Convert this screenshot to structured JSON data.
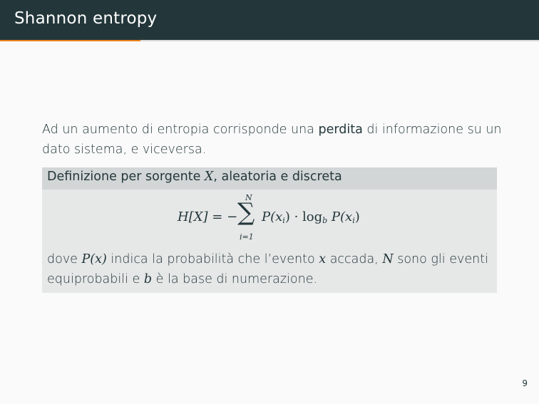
{
  "header": {
    "title": "Shannon entropy"
  },
  "progress": {
    "fraction": 0.26
  },
  "body": {
    "line_pre": "Ad un aumento di entropia corrisponde una ",
    "line_em": "perdita",
    "line_post": " di informazione su un dato sistema, e viceversa."
  },
  "block": {
    "title_pre": "Definizione per sorgente ",
    "title_var": "X",
    "title_post": ", aleatoria e discreta",
    "formula": {
      "lhs": "H[X] = −",
      "sum_symbol": "∑",
      "upper": "N",
      "lower": "i=1",
      "rhs_a": "P(x",
      "rhs_a_sub": "i",
      "rhs_b": ") · log",
      "rhs_b_sub": "b",
      "rhs_c": " P(x",
      "rhs_c_sub": "i",
      "rhs_d": ")"
    },
    "desc_1": "dove ",
    "desc_px": "P(x)",
    "desc_2": " indica la probabilità che l’evento ",
    "desc_x": "x",
    "desc_3": " accada, ",
    "desc_n": "N",
    "desc_4": " sono gli eventi equiprobabili e ",
    "desc_b": "b",
    "desc_5": " è la base di numerazione."
  },
  "page_number": "9"
}
